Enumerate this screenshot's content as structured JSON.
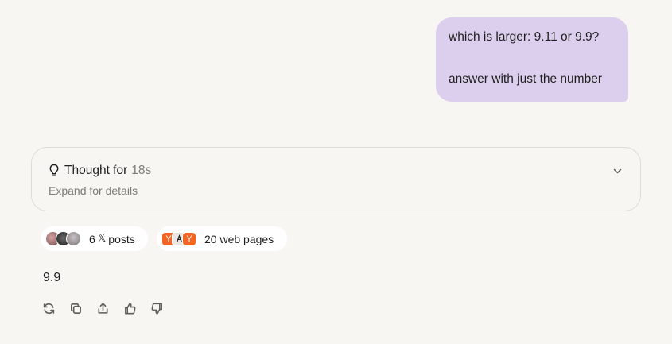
{
  "user_message": {
    "line1": "which is larger: 9.11 or 9.9?",
    "line2": "answer with just the number"
  },
  "thought": {
    "label": "Thought for",
    "duration": "18s",
    "subtitle": "Expand for details",
    "icon": "lightbulb-icon",
    "toggle_icon": "chevron-down-icon"
  },
  "sources": {
    "x_posts": {
      "count": "6",
      "label": "posts"
    },
    "web_pages": {
      "label": "20 web pages"
    }
  },
  "answer": "9.9",
  "actions": [
    "regenerate-icon",
    "copy-icon",
    "share-icon",
    "thumbs-up-icon",
    "thumbs-down-icon"
  ],
  "colors": {
    "background": "#f7f6f3",
    "user_bubble": "#dccfee",
    "pill": "#ffffff",
    "muted_text": "#7d7b77",
    "ycombinator_orange": "#f26522"
  }
}
